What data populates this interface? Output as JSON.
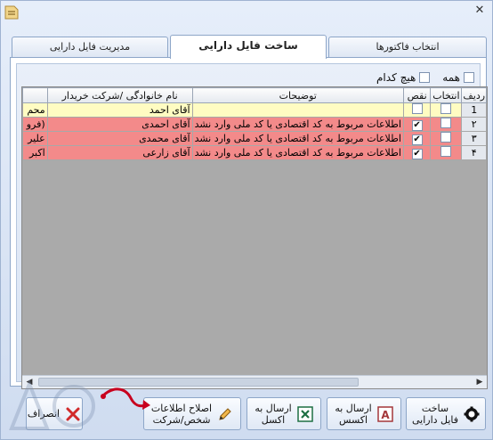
{
  "window": {
    "close_glyph": "✕"
  },
  "tabs": [
    {
      "label": "انتخاب فاکتورها"
    },
    {
      "label": "ساخت فایل دارایی"
    },
    {
      "label": "مدیریت فایل دارایی"
    }
  ],
  "filters": {
    "all_label": "همه",
    "none_label": "هیچ کدام"
  },
  "grid": {
    "columns": [
      "ردیف",
      "انتخاب",
      "نقص",
      "توضیحات",
      "نام خانوادگی /شرکت خریدار",
      ""
    ],
    "rows": [
      {
        "row": "1",
        "selected": false,
        "defect": false,
        "description": "",
        "name": "آقای احمد",
        "extra": "محم"
      },
      {
        "row": "۲",
        "selected": false,
        "defect": true,
        "description": "اطلاعات مربوط به کد اقتصادی یا کد ملی وارد نشد",
        "name": "آقای احمدی",
        "extra": "(فرو"
      },
      {
        "row": "۳",
        "selected": false,
        "defect": true,
        "description": "اطلاعات مربوط به کد اقتصادی یا کد ملی وارد نشد",
        "name": "آقای محمدی",
        "extra": "علیر"
      },
      {
        "row": "۴",
        "selected": false,
        "defect": true,
        "description": "اطلاعات مربوط به کد اقتصادی یا کد ملی وارد نشد",
        "name": "آقای زارعی",
        "extra": "اکبر"
      }
    ]
  },
  "buttons": {
    "build": "ساخت\nفایل دارایی",
    "access": "ارسال به\nاکسس",
    "excel": "ارسال به\nاکسل",
    "fix": "اصلاح اطلاعات\nشخص/شرکت",
    "cancel": "انصراف"
  },
  "colors": {
    "yellow_row": "#fffcc2",
    "red_row": "#f38a8a",
    "accent": "#8da6c8"
  }
}
